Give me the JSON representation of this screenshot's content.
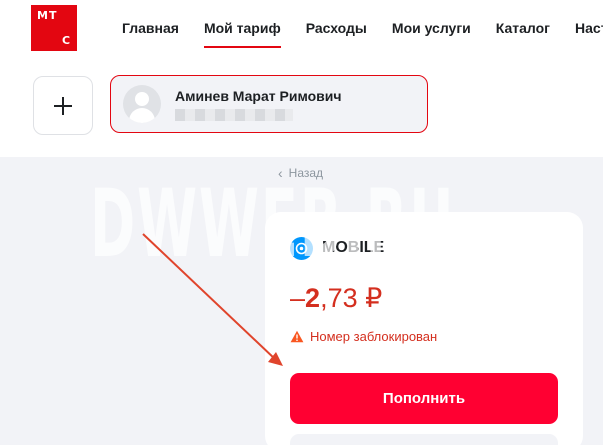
{
  "logo": {
    "letters": [
      "М",
      "Т",
      "С"
    ]
  },
  "nav": {
    "items": [
      {
        "label": "Главная",
        "active": false
      },
      {
        "label": "Мой тариф",
        "active": true
      },
      {
        "label": "Расходы",
        "active": false
      },
      {
        "label": "Мои услуги",
        "active": false
      },
      {
        "label": "Каталог",
        "active": false
      },
      {
        "label": "Настрой",
        "active": false
      }
    ]
  },
  "account": {
    "name": "Аминев Марат Римович"
  },
  "back": {
    "label": "Назад"
  },
  "tariff": {
    "name": "MOBILE",
    "icon": "mobile-tariff-icon"
  },
  "balance": {
    "sign": "–",
    "integer": "2",
    "decimal": ",73",
    "currency": "₽"
  },
  "status": {
    "text": "Номер заблокирован",
    "icon": "warning-icon"
  },
  "actions": {
    "topup_label": "Пополнить"
  },
  "watermark": {
    "text": "DWWEB.RU"
  },
  "colors": {
    "brand": "#e30611",
    "button": "#ff0032",
    "negative": "#d42f1f",
    "background": "#f2f3f7",
    "tariff_icon": "#0097fd"
  }
}
